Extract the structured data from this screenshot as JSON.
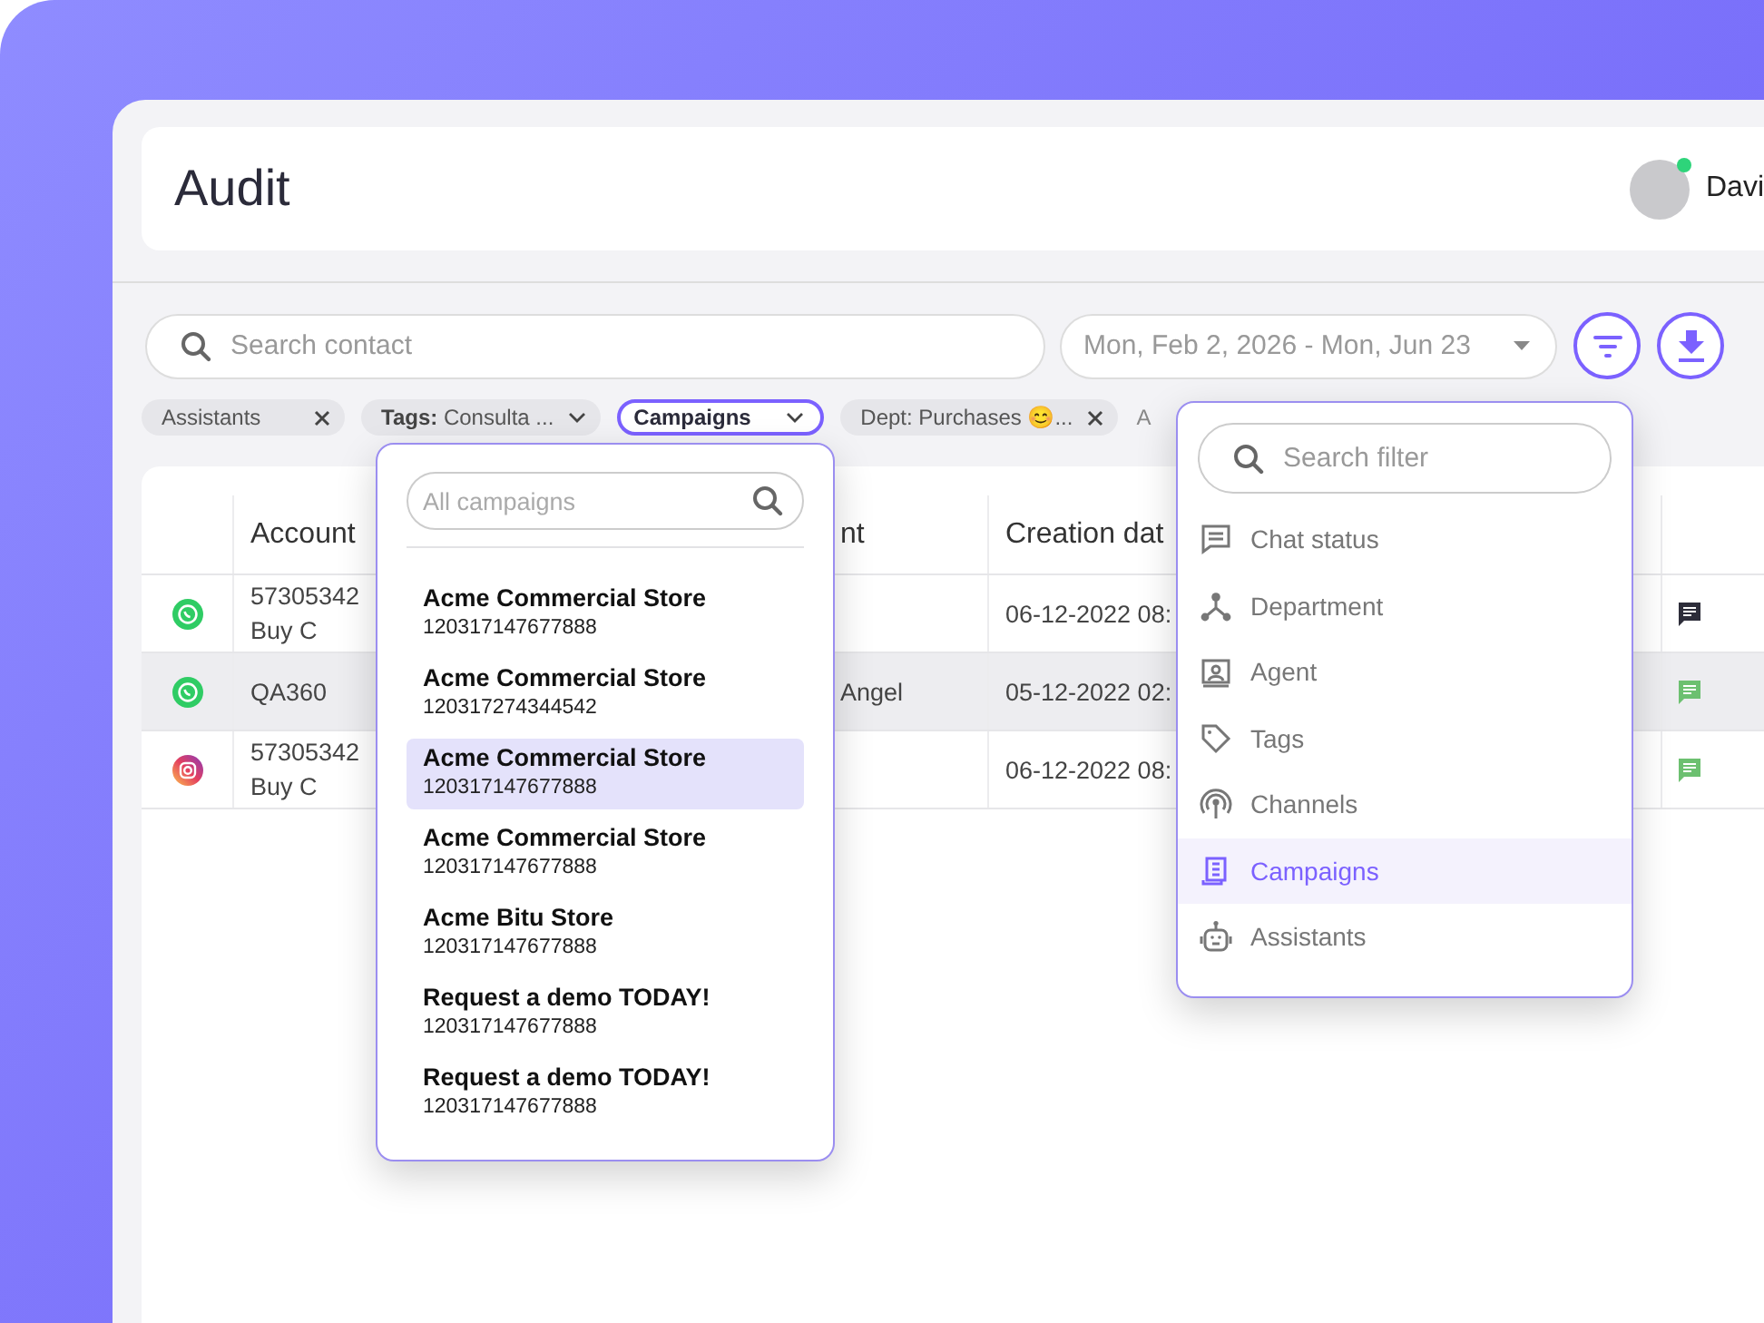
{
  "header": {
    "title": "Audit",
    "user": {
      "name": "Davi",
      "online": true
    }
  },
  "toolbar": {
    "search": {
      "placeholder": "Search contact"
    },
    "date_range": {
      "value": "Mon, Feb 2, 2026 - Mon, Jun 23"
    }
  },
  "filter_chips": [
    {
      "label": "Assistants",
      "kind": "removable",
      "selected": false
    },
    {
      "label": "**Tags:** Consulta ...",
      "kind": "dropdown",
      "selected": false
    },
    {
      "label": "Campaigns",
      "kind": "dropdown",
      "selected": true
    },
    {
      "label": "Dept: Purchases 😊...",
      "kind": "removable",
      "selected": false
    },
    {
      "label": "A",
      "kind": "plain",
      "selected": false
    }
  ],
  "table": {
    "columns": {
      "account": "Account",
      "column_3": "nt",
      "creation_date": "Creation dat"
    },
    "rows": [
      {
        "kind": "whatsapp",
        "account": "57305342",
        "account_detail": "Buy C",
        "creation_date": "06-12-2022 08:",
        "color": "#2d2d3a",
        "highlighted": false
      },
      {
        "kind": "whatsapp",
        "account": "QA360",
        "column_3": "Angel",
        "creation_date": "05-12-2022 02:",
        "color": "#6cc070",
        "highlighted": true
      },
      {
        "kind": "instagram",
        "account": "57305342",
        "account_detail": "Buy C",
        "creation_date": "06-12-2022 08:",
        "color": "#6cc070",
        "highlighted": false
      }
    ]
  },
  "campaign_dropdown": {
    "search": {
      "placeholder": "All campaigns"
    },
    "items": [
      {
        "name": "Acme Commercial Store",
        "id": "120317147677888",
        "selected": false
      },
      {
        "name": "Acme Commercial Store",
        "id": "120317274344542",
        "selected": false
      },
      {
        "name": "Acme Commercial Store",
        "id": "120317147677888",
        "selected": true
      },
      {
        "name": "Acme Commercial Store",
        "id": "120317147677888",
        "selected": false
      },
      {
        "name": "Acme Bitu Store",
        "id": "120317147677888",
        "selected": false
      },
      {
        "name": "Request a demo TODAY!",
        "id": "120317147677888",
        "selected": false
      },
      {
        "name": "Request a demo TODAY!",
        "id": "120317147677888",
        "selected": false
      }
    ]
  },
  "filter_menu": {
    "search": {
      "placeholder": "Search filter"
    },
    "items": [
      {
        "label": "Chat status",
        "kind": "chat-status",
        "selected": false
      },
      {
        "label": "Department",
        "kind": "department",
        "selected": false
      },
      {
        "label": "Agent",
        "kind": "agent",
        "selected": false
      },
      {
        "label": "Tags",
        "kind": "tags",
        "selected": false
      },
      {
        "label": "Channels",
        "kind": "channels",
        "selected": false
      },
      {
        "label": "Campaigns",
        "kind": "campaigns",
        "selected": true
      },
      {
        "label": "Assistants",
        "kind": "assistants",
        "selected": false
      }
    ]
  }
}
